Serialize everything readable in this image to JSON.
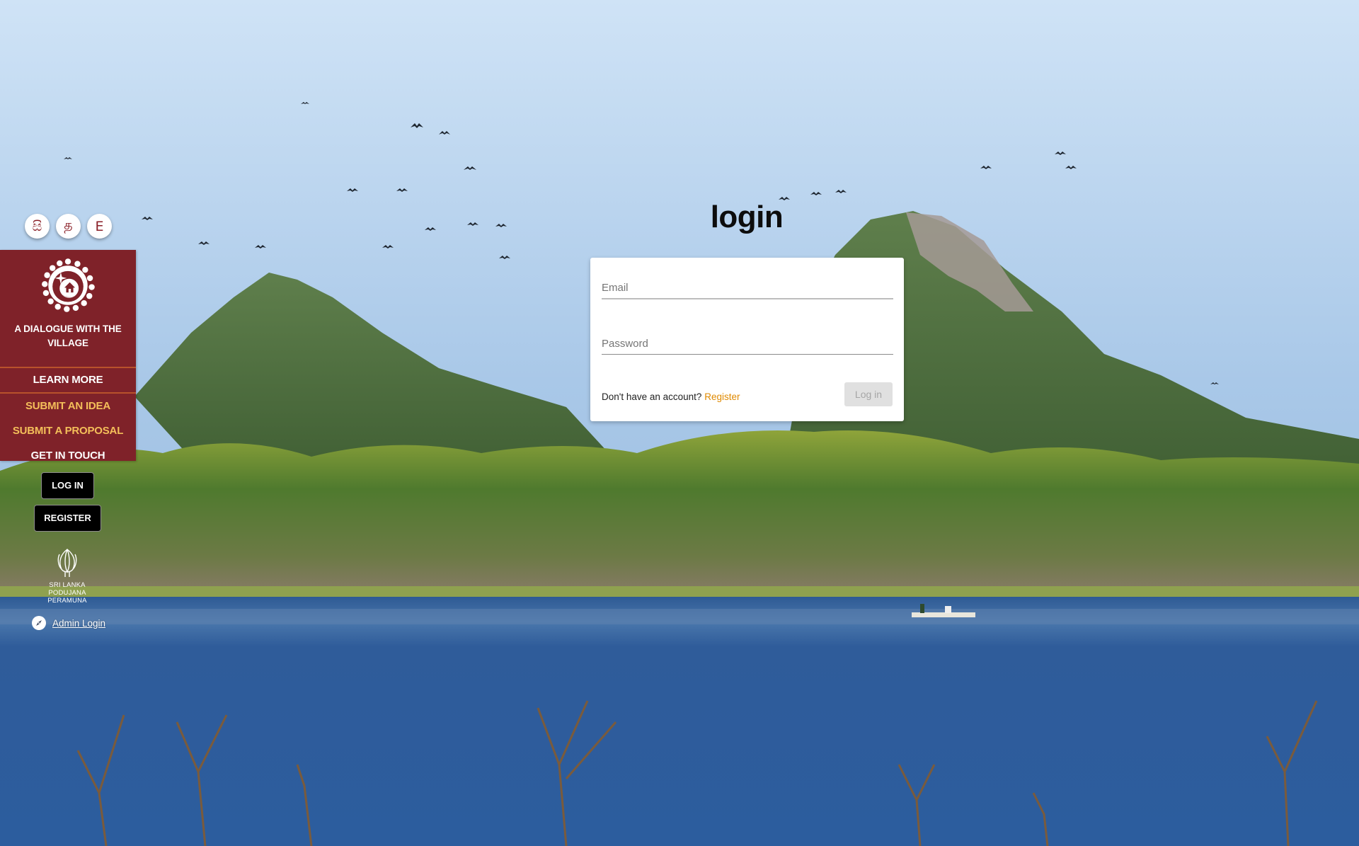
{
  "language_switcher": [
    {
      "label": "සි",
      "language": "Sinhala"
    },
    {
      "label": "த",
      "language": "Tamil"
    },
    {
      "label": "E",
      "language": "English"
    }
  ],
  "sidebar": {
    "logo_icon": "dialogue-village-emblem-icon",
    "brand_text": "A DIALOGUE WITH THE VILLAGE",
    "nav": [
      {
        "label": "LEARN MORE",
        "color": "#ffffff"
      },
      {
        "label": "SUBMIT AN IDEA",
        "color": "#f4bf5a"
      },
      {
        "label": "SUBMIT A PROPOSAL",
        "color": "#f4bf5a"
      },
      {
        "label": "GET IN TOUCH",
        "color": "#ffffff"
      }
    ],
    "log_in_label": "LOG IN",
    "register_label": "REGISTER",
    "party_logo_icon": "lotus-bud-icon",
    "party_name_lines": [
      "SRI LANKA",
      "PODUJANA",
      "PERAMUNA"
    ],
    "admin_icon": "compass-icon",
    "admin_login_label": "Admin Login"
  },
  "login": {
    "title": "login",
    "email_placeholder": "Email",
    "email_value": "",
    "password_placeholder": "Password",
    "password_value": "",
    "no_account_text": "Don't have an account?",
    "register_link": "Register",
    "submit_label": "Log in",
    "submit_disabled": true
  },
  "colors": {
    "sidebar_bg": "#7f2229",
    "sidebar_divider": "#b8522b",
    "accent_gold": "#f4bf5a",
    "link_orange": "#e08a00"
  }
}
